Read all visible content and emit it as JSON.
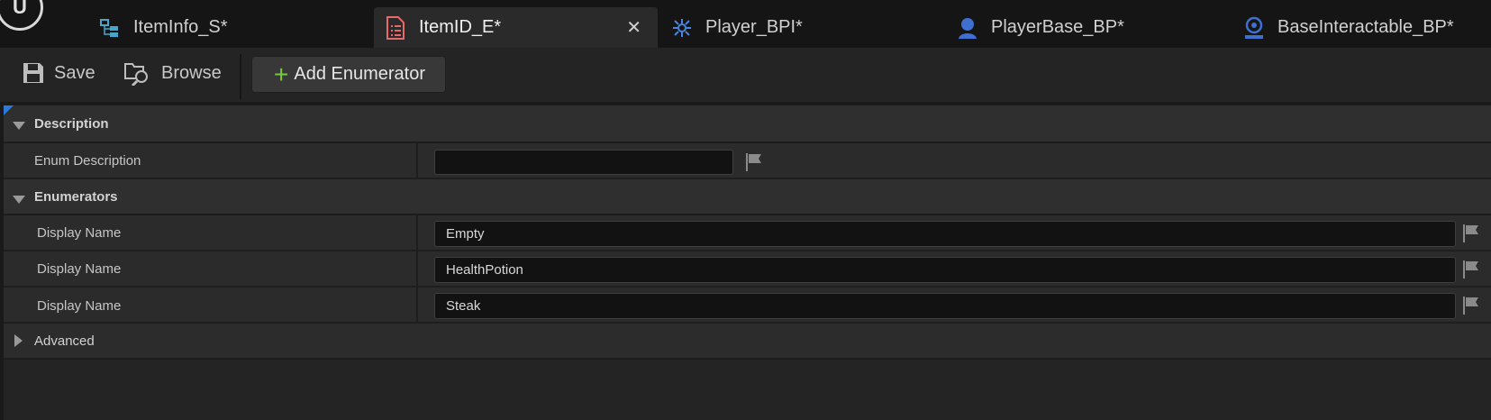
{
  "tabs": [
    {
      "label": "ItemInfo_S*",
      "icon": "struct-icon",
      "active": false
    },
    {
      "label": "ItemID_E*",
      "icon": "enum-document-icon",
      "active": true,
      "close": "✕"
    },
    {
      "label": "Player_BPI*",
      "icon": "interface-icon",
      "active": false
    },
    {
      "label": "PlayerBase_BP*",
      "icon": "pawn-icon",
      "active": false
    },
    {
      "label": "BaseInteractable_BP*",
      "icon": "actor-icon",
      "active": false
    }
  ],
  "toolbar": {
    "save_label": "Save",
    "browse_label": "Browse",
    "add_label": "Add Enumerator"
  },
  "details": {
    "description_category": "Description",
    "enum_description_label": "Enum Description",
    "enum_description_value": "",
    "enumerators_category": "Enumerators",
    "enumerators": [
      {
        "label": "Display Name",
        "value": "Empty"
      },
      {
        "label": "Display Name",
        "value": "HealthPotion"
      },
      {
        "label": "Display Name",
        "value": "Steak"
      }
    ],
    "advanced_category": "Advanced"
  },
  "colors": {
    "accent_blue": "#2a7ad8",
    "add_green": "#7ac943",
    "enum_icon": "#e56a6a"
  }
}
